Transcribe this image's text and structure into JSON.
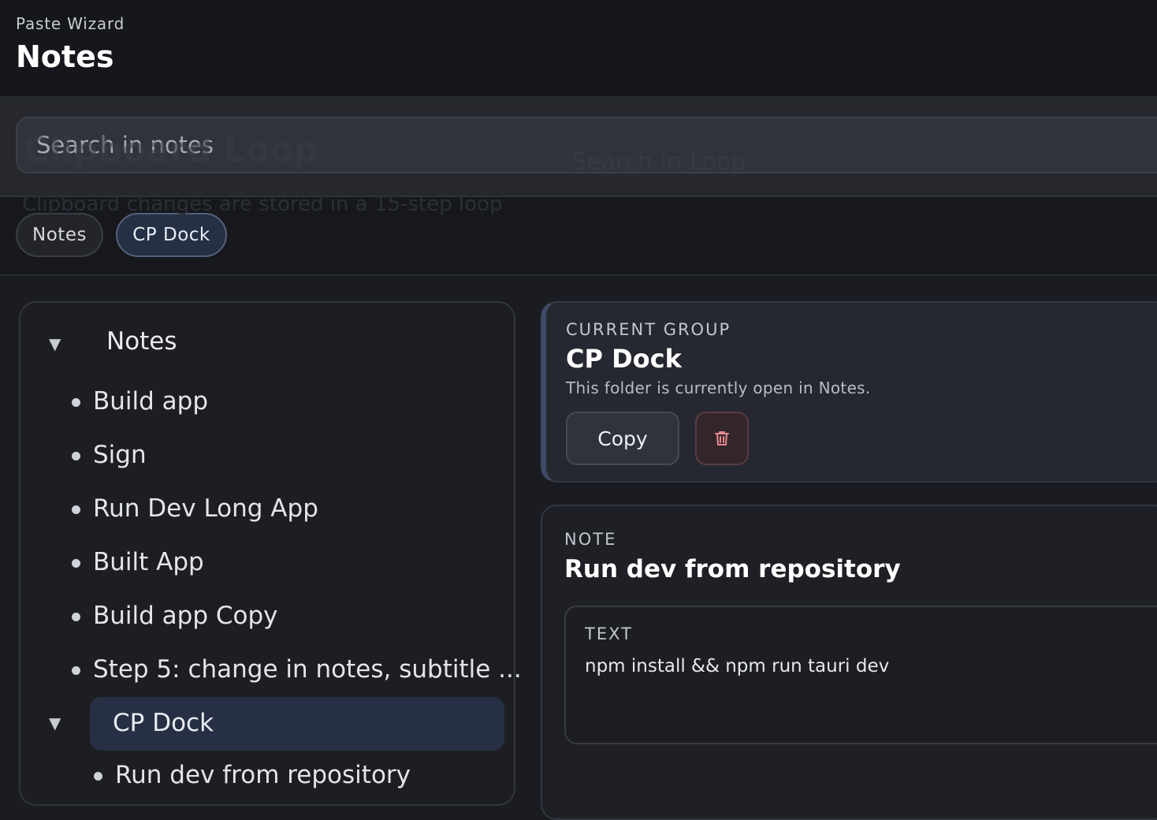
{
  "header": {
    "app_name": "Paste Wizard",
    "title": "Notes"
  },
  "search": {
    "placeholder": "Search in notes"
  },
  "ghost_text": {
    "title": "Clipboard Loop",
    "search": "Search in Loop",
    "subtitle": "Clipboard changes are stored in a 15-step loop"
  },
  "chips": [
    {
      "label": "Notes",
      "selected": false
    },
    {
      "label": "CP Dock",
      "selected": true
    }
  ],
  "tree": {
    "groups": [
      {
        "label": "Notes",
        "expanded": true,
        "items": [
          "Build app",
          "Sign",
          "Run Dev Long App",
          "Built App",
          "Build app Copy",
          "Step 5: change in notes, subtitle ..."
        ]
      },
      {
        "label": "CP Dock",
        "expanded": true,
        "selected": true,
        "items": [
          "Run dev from repository"
        ]
      }
    ]
  },
  "current_group": {
    "eyebrow": "CURRENT GROUP",
    "name": "CP Dock",
    "description": "This folder is currently open in Notes.",
    "copy_label": "Copy",
    "delete_icon": "trash-icon"
  },
  "note": {
    "eyebrow": "NOTE",
    "title": "Run dev from repository",
    "text_label": "TEXT",
    "text": "npm install && npm run tauri dev"
  },
  "colors": {
    "background": "#1a1c21",
    "header": "#15171c",
    "accent_selected": "#262f44",
    "delete_tint": "#e88a8f"
  }
}
